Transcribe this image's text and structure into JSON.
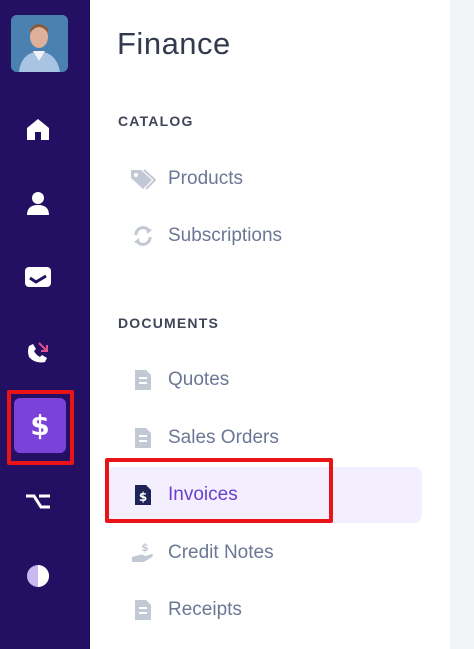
{
  "sidebar": {
    "avatar_alt": "User avatar",
    "icons": [
      "home-icon",
      "user-icon",
      "inbox-icon",
      "phone-icon",
      "dollar-icon",
      "flow-icon",
      "pie-chart-icon"
    ],
    "active": "dollar-icon",
    "active_glyph": "$"
  },
  "panel": {
    "title": "Finance",
    "sections": [
      {
        "heading": "CATALOG",
        "items": [
          "Products",
          "Subscriptions"
        ]
      },
      {
        "heading": "DOCUMENTS",
        "items": [
          "Quotes",
          "Sales Orders",
          "Invoices",
          "Credit Notes",
          "Receipts"
        ]
      }
    ],
    "active_item": "Invoices"
  },
  "colors": {
    "rail_bg": "#241063",
    "accent": "#7a42d8",
    "active_text": "#6c3fcc",
    "highlight": "#ea1418"
  }
}
